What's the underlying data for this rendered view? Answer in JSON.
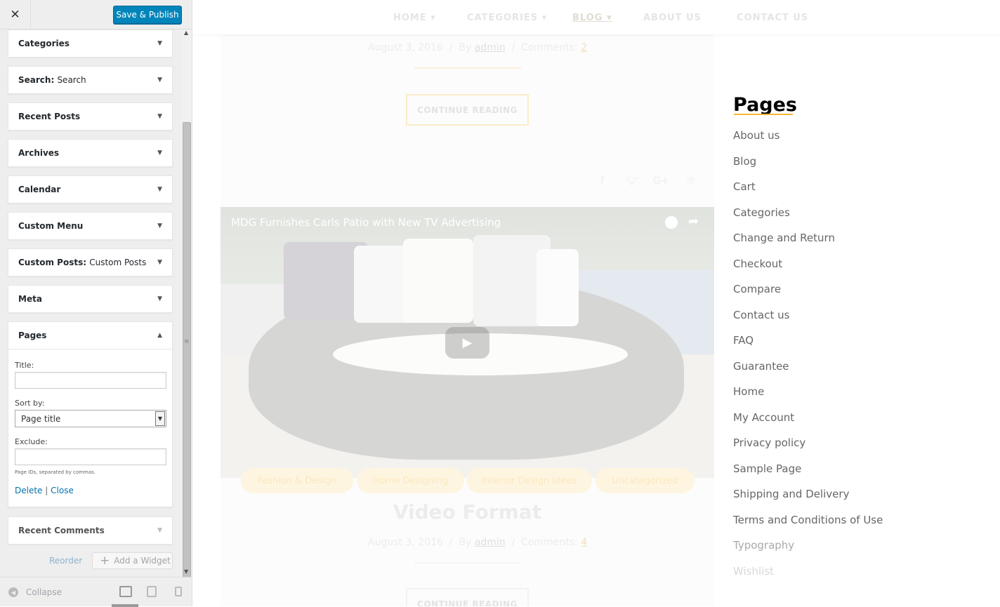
{
  "customizer": {
    "close_label": "✕",
    "publish_label": "Save & Publish",
    "widgets": [
      {
        "name": "Categories",
        "subtitle": ""
      },
      {
        "name": "Search",
        "subtitle": "Search"
      },
      {
        "name": "Recent Posts",
        "subtitle": ""
      },
      {
        "name": "Archives",
        "subtitle": ""
      },
      {
        "name": "Calendar",
        "subtitle": ""
      },
      {
        "name": "Custom Menu",
        "subtitle": ""
      },
      {
        "name": "Custom Posts",
        "subtitle": "Custom Posts"
      },
      {
        "name": "Meta",
        "subtitle": ""
      }
    ],
    "pages_widget": {
      "name": "Pages",
      "title_label": "Title:",
      "title_value": "",
      "sortby_label": "Sort by:",
      "sortby_value": "Page title",
      "exclude_label": "Exclude:",
      "exclude_value": "",
      "exclude_hint": "Page IDs, separated by commas.",
      "delete_label": "Delete",
      "separator": "|",
      "close_label": "Close"
    },
    "recent_comments": "Recent Comments",
    "reorder_label": "Reorder",
    "add_widget_label": "Add a Widget",
    "collapse_label": "Collapse"
  },
  "preview": {
    "nav": [
      "HOME",
      "CATEGORIES",
      "BLOG",
      "ABOUT US",
      "CONTACT US"
    ],
    "post1": {
      "date": "August 3, 2016",
      "by": "By",
      "author": "admin",
      "comments_label": "Comments:",
      "comments": "2",
      "continue": "CONTINUE READING"
    },
    "video_title": "MDG Furnishes Carls Patio with New TV Advertising",
    "tags": [
      "Fashion & Design",
      "Home Designing",
      "Interior Design Ideas",
      "Uncategorized"
    ],
    "post2": {
      "title": "Video Format",
      "date": "August 3, 2016",
      "by": "By",
      "author": "admin",
      "comments_label": "Comments:",
      "comments": "4",
      "continue": "CONTINUE READING"
    },
    "sidebar": {
      "title": "Pages",
      "links": [
        "About us",
        "Blog",
        "Cart",
        "Categories",
        "Change and Return",
        "Checkout",
        "Compare",
        "Contact us",
        "FAQ",
        "Guarantee",
        "Home",
        "My Account",
        "Privacy policy",
        "Sample Page",
        "Shipping and Delivery",
        "Terms and Conditions of Use",
        "Typography",
        "Wishlist"
      ]
    }
  }
}
